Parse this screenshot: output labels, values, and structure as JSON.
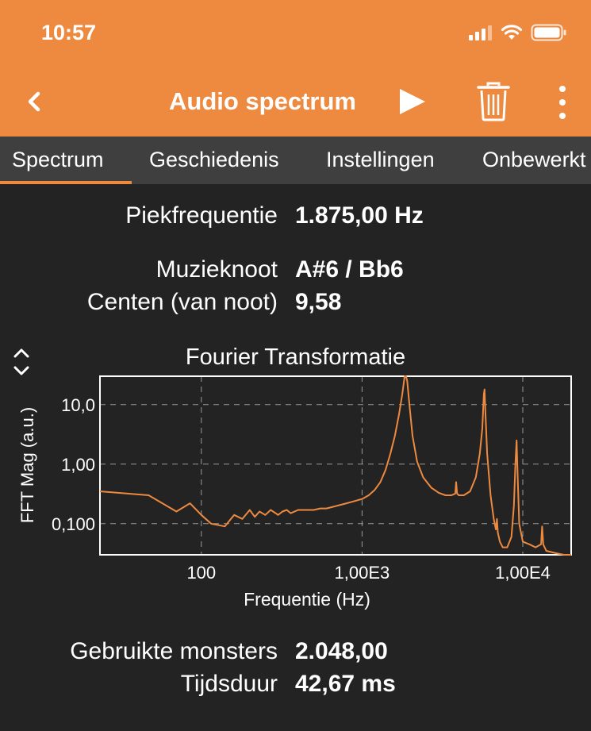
{
  "status": {
    "time": "10:57"
  },
  "nav": {
    "title": "Audio spectrum",
    "icons": [
      "back-chevron-icon",
      "play-icon",
      "trash-icon",
      "more-vertical-icon"
    ]
  },
  "tabs": [
    {
      "label": "Spectrum",
      "active": true
    },
    {
      "label": "Geschiedenis",
      "active": false
    },
    {
      "label": "Instellingen",
      "active": false
    },
    {
      "label": "Onbewerkt",
      "active": false
    }
  ],
  "readouts": {
    "peak_label": "Piekfrequentie",
    "peak_value": "1.875,00 Hz",
    "note_label": "Muzieknoot",
    "note_value": "A#6 / Bb6",
    "cents_label": "Centen (van noot)",
    "cents_value": "9,58",
    "samples_label": "Gebruikte monsters",
    "samples_value": "2.048,00",
    "duration_label": "Tijdsduur",
    "duration_value": "42,67 ms"
  },
  "colors": {
    "accent": "#ee8a3f",
    "background": "#232323",
    "tabbar": "#3f3f3f",
    "line": "#ee8a3f"
  },
  "chart_data": {
    "type": "line",
    "title": "Fourier Transformatie",
    "xlabel": "Frequentie (Hz)",
    "ylabel": "FFT Mag (a.u.)",
    "xscale": "log",
    "yscale": "log",
    "xlim": [
      23.4,
      20000
    ],
    "ylim": [
      0.03,
      30
    ],
    "xticks": [
      "100",
      "1,00E3",
      "1,00E4"
    ],
    "yticks": [
      "0,100",
      "1,00",
      "10,0"
    ],
    "grid": true,
    "series": [
      {
        "x": [
          23.4,
          47,
          70,
          85,
          100,
          115,
          140,
          160,
          180,
          200,
          215,
          230,
          250,
          270,
          290,
          300,
          320,
          340,
          360,
          400,
          450,
          500,
          550,
          600,
          650,
          700,
          750,
          800,
          850,
          900,
          950,
          1000,
          1100,
          1200,
          1300,
          1400,
          1500,
          1600,
          1700,
          1780,
          1840,
          1875,
          1910,
          1970,
          2060,
          2200,
          2400,
          2700,
          3000,
          3300,
          3600,
          3800,
          3850,
          3900,
          4000,
          4300,
          4700,
          5100,
          5400,
          5600,
          5720,
          5780,
          5850,
          6000,
          6300,
          6600,
          6800,
          6900,
          7000,
          7200,
          7500,
          8000,
          8500,
          8800,
          9000,
          9150,
          9300,
          9500,
          10000,
          11000,
          12000,
          13000,
          13200,
          13400,
          14000,
          16000,
          18000,
          20000
        ],
        "values": [
          0.35,
          0.3,
          0.16,
          0.22,
          0.14,
          0.1,
          0.09,
          0.14,
          0.12,
          0.17,
          0.13,
          0.16,
          0.14,
          0.17,
          0.15,
          0.14,
          0.16,
          0.17,
          0.15,
          0.17,
          0.17,
          0.17,
          0.18,
          0.18,
          0.19,
          0.2,
          0.21,
          0.22,
          0.23,
          0.24,
          0.25,
          0.26,
          0.3,
          0.37,
          0.5,
          0.8,
          1.5,
          3.0,
          7.0,
          15.0,
          30.0,
          30.0,
          25.0,
          10.0,
          3.0,
          1.1,
          0.6,
          0.4,
          0.33,
          0.3,
          0.3,
          0.32,
          0.5,
          0.32,
          0.3,
          0.3,
          0.35,
          0.6,
          1.5,
          4.0,
          15.0,
          18.0,
          8.0,
          1.5,
          0.3,
          0.12,
          0.08,
          0.12,
          0.07,
          0.05,
          0.04,
          0.04,
          0.06,
          0.2,
          1.0,
          2.5,
          0.6,
          0.1,
          0.05,
          0.045,
          0.04,
          0.045,
          0.09,
          0.045,
          0.035,
          0.032,
          0.03,
          0.028
        ]
      }
    ]
  }
}
